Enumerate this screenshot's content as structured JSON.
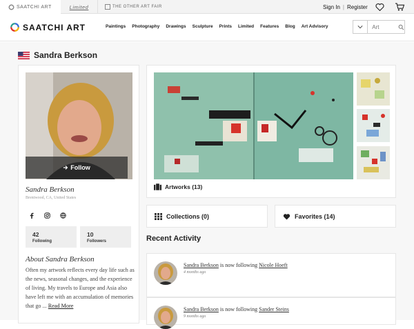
{
  "topbar": {
    "tab_saatchi": "SAATCHI ART",
    "tab_limited": "Limited",
    "tab_fair": "THE OTHER ART FAIR",
    "sign_in": "Sign In",
    "separator": "|",
    "register": "Register"
  },
  "nav": {
    "logo": "SAATCHI ART",
    "links": [
      "Paintings",
      "Photography",
      "Drawings",
      "Sculpture",
      "Prints",
      "Limited",
      "Features",
      "Blog",
      "Art Advisory"
    ],
    "search_placeholder": "Art"
  },
  "profile": {
    "name": "Sandra Berkson",
    "follow_label": "Follow",
    "display_name": "Sandra Berkson",
    "location": "Brentwood, CA, United States",
    "following_count": "42",
    "following_label": "Following",
    "followers_count": "10",
    "followers_label": "Followers",
    "about_title": "About Sandra Berkson",
    "about_text": "Often my artwork reflects every day life such as the news, seasonal changes, and the experience of living. My travels to Europe and Asia also have left me with an accumulation of memories that go ...",
    "read_more": "Read More"
  },
  "artworks_label": "Artworks (13)",
  "collections_label": "Collections (0)",
  "favorites_label": "Favorites (14)",
  "recent_activity_title": "Recent Activity",
  "activity": [
    {
      "actor": "Sandra Berkson",
      "verb": "is now following",
      "target": "Nicole Hoeft",
      "time": "4 months ago"
    },
    {
      "actor": "Sandra Berkson",
      "verb": "is now following",
      "target": "Sander Steins",
      "time": "9 months ago"
    }
  ],
  "colors": {
    "accent_yellow": "#f5b400",
    "accent_red": "#e0332b",
    "accent_teal": "#2a9d8f",
    "accent_blue": "#3a6fd8"
  }
}
